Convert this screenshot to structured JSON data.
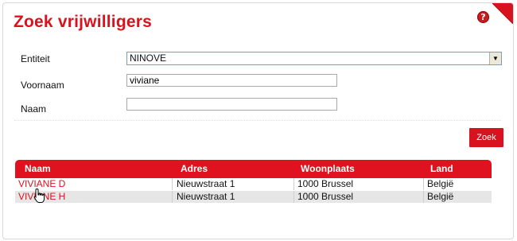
{
  "page": {
    "title": "Zoek vrijwilligers",
    "help_symbol": "?"
  },
  "form": {
    "entity_label": "Entiteit",
    "entity_value": "NINOVE",
    "firstname_label": "Voornaam",
    "firstname_value": "viviane",
    "lastname_label": "Naam",
    "lastname_value": "",
    "search_button": "Zoek"
  },
  "results": {
    "headers": [
      "Naam",
      "Adres",
      "Woonplaats",
      "Land"
    ],
    "rows": [
      {
        "name": "VIVIANE D",
        "address": "Nieuwstraat 1",
        "city": "1000 Brussel",
        "country": "België"
      },
      {
        "name": "VIVIANE H",
        "address": "Nieuwstraat 1",
        "city": "1000 Brussel",
        "country": "België"
      }
    ]
  },
  "colors": {
    "accent": "#d8121f",
    "row_alt": "#e6e6e6"
  },
  "icons": {
    "help": "question-circle-icon",
    "corner": "page-fold-corner",
    "dropdown": "chevron-down-icon",
    "cursor": "hand-pointer-cursor"
  }
}
